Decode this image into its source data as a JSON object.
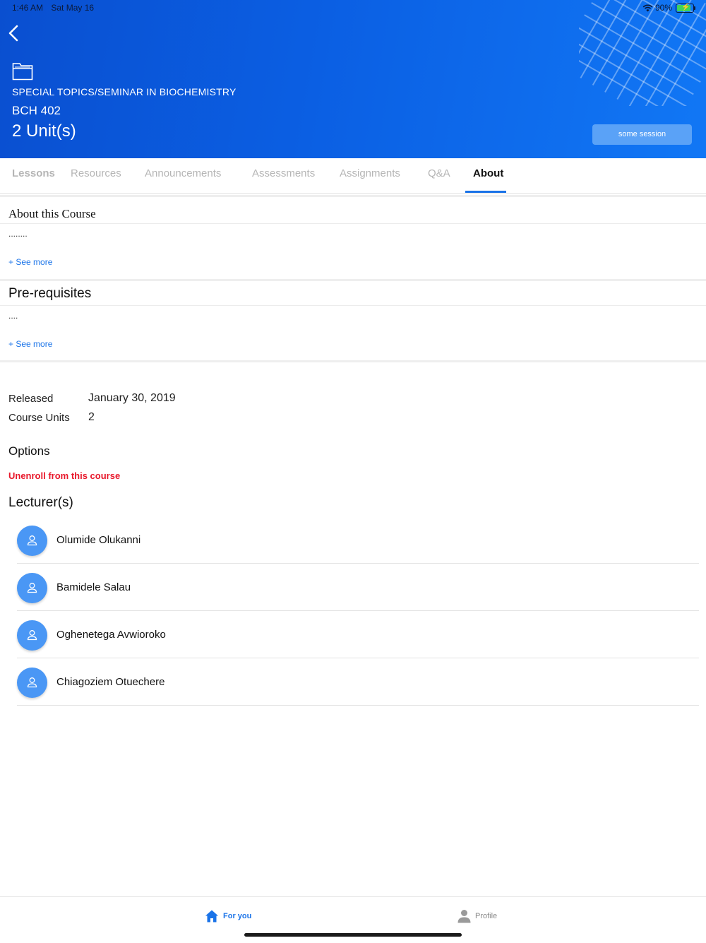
{
  "status_bar": {
    "time": "1:46 AM",
    "date": "Sat May 16",
    "battery": "90%"
  },
  "header": {
    "course_name": "SPECIAL TOPICS/SEMINAR IN BIOCHEMISTRY",
    "course_code": "BCH 402",
    "units": "2 Unit(s)",
    "session_button": "some session"
  },
  "tabs": [
    "Lessons",
    "Resources",
    "Announcements",
    "Assessments",
    "Assignments",
    "Q&A",
    "About"
  ],
  "about": {
    "title": "About this Course",
    "body": "........",
    "see_more": "+ See more"
  },
  "prerequisites": {
    "title": "Pre-requisites",
    "body": "....",
    "see_more": "+ See more"
  },
  "meta": {
    "released_label": "Released",
    "released_value": "January 30, 2019",
    "units_label": "Course Units",
    "units_value": "2"
  },
  "options": {
    "title": "Options",
    "unenroll": "Unenroll from this course"
  },
  "lecturers": {
    "title": "Lecturer(s)",
    "names": [
      "Olumide Olukanni",
      "Bamidele Salau",
      "Oghenetega Avwioroko",
      "Chiagoziem Otuechere"
    ]
  },
  "bottom_nav": {
    "for_you": "For you",
    "profile": "Profile"
  },
  "colors": {
    "header_blue": "#0b5fe3",
    "accent": "#1a73e8",
    "danger": "#e8182b",
    "avatar": "#4a97f5"
  }
}
